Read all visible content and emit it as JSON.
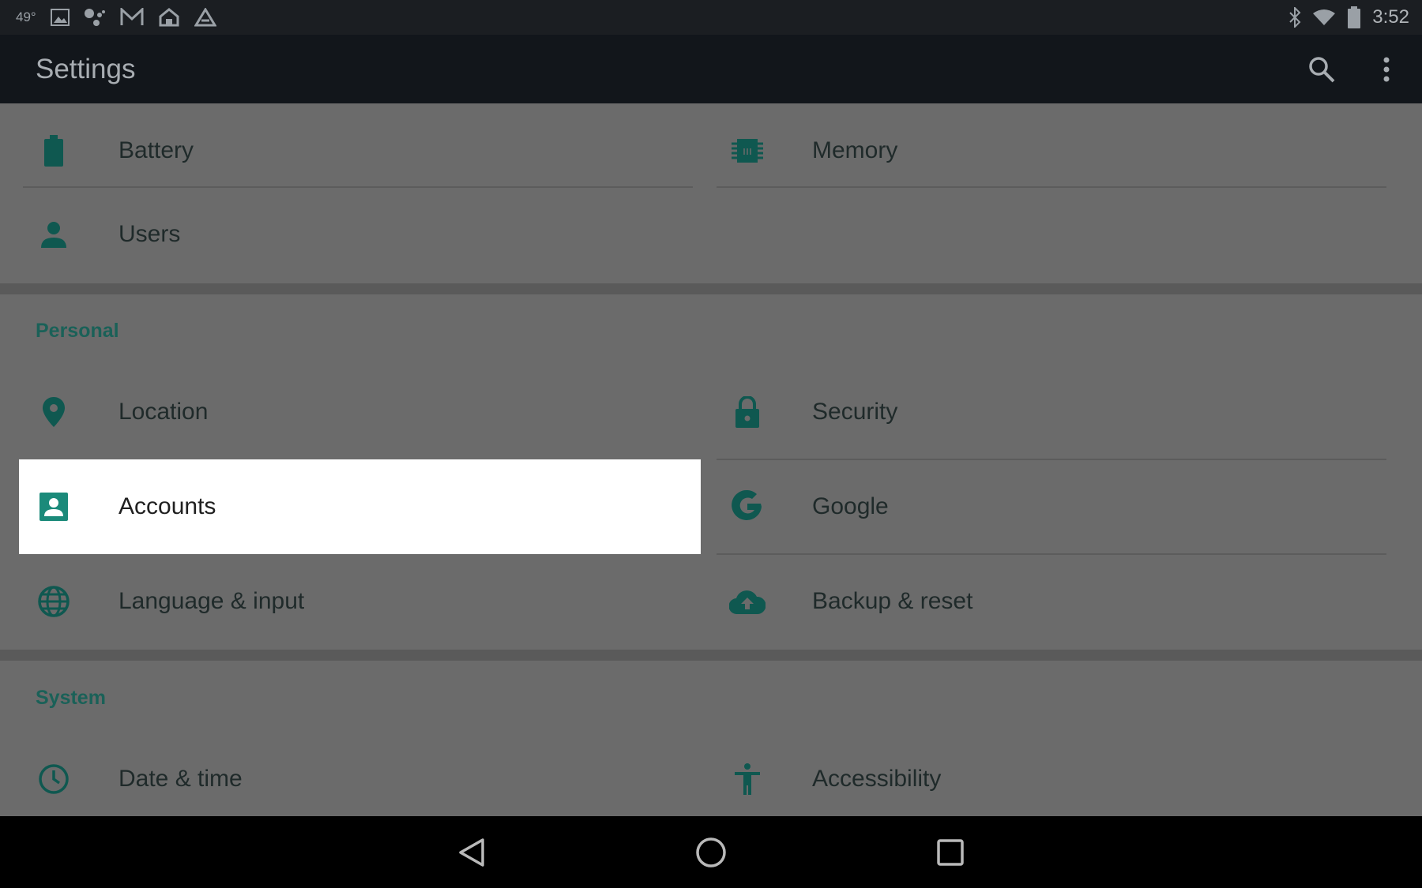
{
  "status_bar": {
    "temperature": "49°",
    "time": "3:52",
    "left_icons": [
      "image-icon",
      "assistant-icon",
      "gmail-icon",
      "home-icon",
      "drive-icon"
    ],
    "right_icons": [
      "bluetooth-icon",
      "wifi-icon",
      "battery-icon"
    ]
  },
  "app_bar": {
    "title": "Settings",
    "actions": [
      "search-icon",
      "more-vert-icon"
    ]
  },
  "rows_top": [
    {
      "label": "Battery",
      "icon": "battery-icon"
    },
    {
      "label": "Memory",
      "icon": "memory-icon"
    },
    {
      "label": "Users",
      "icon": "person-icon"
    }
  ],
  "personal": {
    "title": "Personal",
    "items": [
      {
        "label": "Location",
        "icon": "location-icon"
      },
      {
        "label": "Security",
        "icon": "lock-icon"
      },
      {
        "label": "Accounts",
        "icon": "account-box-icon"
      },
      {
        "label": "Google",
        "icon": "google-icon"
      },
      {
        "label": "Language & input",
        "icon": "globe-icon"
      },
      {
        "label": "Backup & reset",
        "icon": "cloud-upload-icon"
      }
    ]
  },
  "system": {
    "title": "System",
    "items": [
      {
        "label": "Date & time",
        "icon": "clock-icon"
      },
      {
        "label": "Accessibility",
        "icon": "accessibility-icon"
      }
    ]
  },
  "nav_bar": {
    "buttons": [
      "back-icon",
      "home-circle-icon",
      "recents-icon"
    ]
  },
  "colors": {
    "accent": "#1a6158",
    "icon": "#0f5850",
    "highlight": "#ffffff",
    "background": "#6b6b6b",
    "app_bar": "#12161b"
  }
}
